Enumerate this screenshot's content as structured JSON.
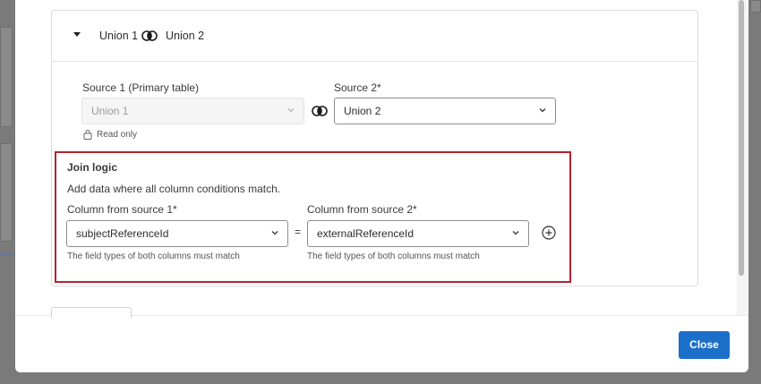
{
  "card": {
    "header": {
      "left_name": "Union 1",
      "right_name": "Union 2",
      "join_icon": "join-circles-icon",
      "toggle_icon": "caret-down-icon"
    },
    "source1": {
      "label": "Source 1 (Primary table)",
      "value": "Union 1",
      "readonly_text": "Read only",
      "lock_icon": "lock-icon"
    },
    "source2": {
      "label": "Source 2*",
      "value": "Union 2"
    },
    "join_logic": {
      "title": "Join logic",
      "description": "Add data where all column conditions match.",
      "column1_label": "Column from source 1*",
      "column1_value": "subjectReferenceId",
      "column1_help": "The field types of both columns must match",
      "equals": "=",
      "column2_label": "Column from source 2*",
      "column2_value": "externalReferenceId",
      "column2_help": "The field types of both columns must match",
      "add_icon": "plus-circle-icon"
    }
  },
  "footer": {
    "close_label": "Close"
  },
  "colors": {
    "accent": "#1b6fc9",
    "highlight": "#b2242f"
  }
}
